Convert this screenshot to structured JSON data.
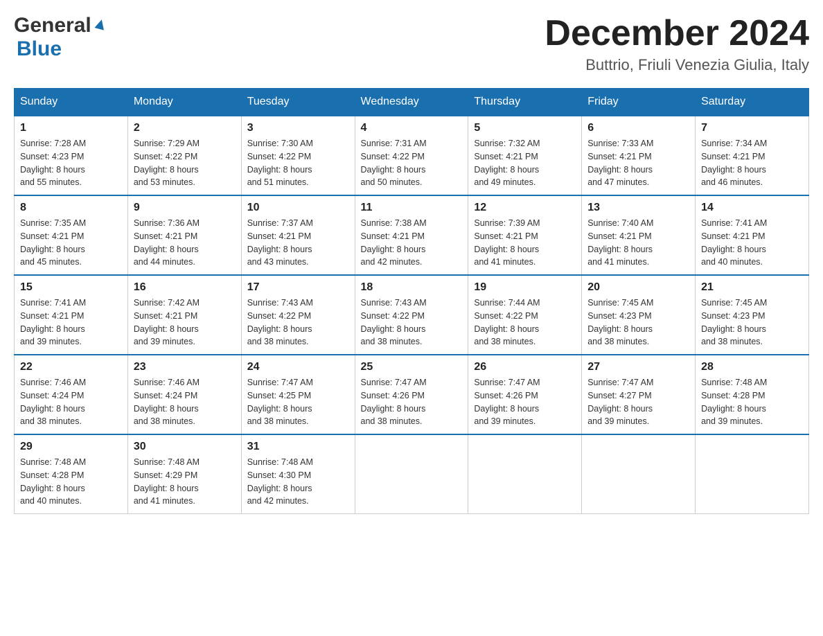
{
  "header": {
    "logo_general": "General",
    "logo_blue": "Blue",
    "month_title": "December 2024",
    "location": "Buttrio, Friuli Venezia Giulia, Italy"
  },
  "days_of_week": [
    "Sunday",
    "Monday",
    "Tuesday",
    "Wednesday",
    "Thursday",
    "Friday",
    "Saturday"
  ],
  "weeks": [
    [
      {
        "day": "1",
        "sunrise": "7:28 AM",
        "sunset": "4:23 PM",
        "daylight": "8 hours and 55 minutes."
      },
      {
        "day": "2",
        "sunrise": "7:29 AM",
        "sunset": "4:22 PM",
        "daylight": "8 hours and 53 minutes."
      },
      {
        "day": "3",
        "sunrise": "7:30 AM",
        "sunset": "4:22 PM",
        "daylight": "8 hours and 51 minutes."
      },
      {
        "day": "4",
        "sunrise": "7:31 AM",
        "sunset": "4:22 PM",
        "daylight": "8 hours and 50 minutes."
      },
      {
        "day": "5",
        "sunrise": "7:32 AM",
        "sunset": "4:21 PM",
        "daylight": "8 hours and 49 minutes."
      },
      {
        "day": "6",
        "sunrise": "7:33 AM",
        "sunset": "4:21 PM",
        "daylight": "8 hours and 47 minutes."
      },
      {
        "day": "7",
        "sunrise": "7:34 AM",
        "sunset": "4:21 PM",
        "daylight": "8 hours and 46 minutes."
      }
    ],
    [
      {
        "day": "8",
        "sunrise": "7:35 AM",
        "sunset": "4:21 PM",
        "daylight": "8 hours and 45 minutes."
      },
      {
        "day": "9",
        "sunrise": "7:36 AM",
        "sunset": "4:21 PM",
        "daylight": "8 hours and 44 minutes."
      },
      {
        "day": "10",
        "sunrise": "7:37 AM",
        "sunset": "4:21 PM",
        "daylight": "8 hours and 43 minutes."
      },
      {
        "day": "11",
        "sunrise": "7:38 AM",
        "sunset": "4:21 PM",
        "daylight": "8 hours and 42 minutes."
      },
      {
        "day": "12",
        "sunrise": "7:39 AM",
        "sunset": "4:21 PM",
        "daylight": "8 hours and 41 minutes."
      },
      {
        "day": "13",
        "sunrise": "7:40 AM",
        "sunset": "4:21 PM",
        "daylight": "8 hours and 41 minutes."
      },
      {
        "day": "14",
        "sunrise": "7:41 AM",
        "sunset": "4:21 PM",
        "daylight": "8 hours and 40 minutes."
      }
    ],
    [
      {
        "day": "15",
        "sunrise": "7:41 AM",
        "sunset": "4:21 PM",
        "daylight": "8 hours and 39 minutes."
      },
      {
        "day": "16",
        "sunrise": "7:42 AM",
        "sunset": "4:21 PM",
        "daylight": "8 hours and 39 minutes."
      },
      {
        "day": "17",
        "sunrise": "7:43 AM",
        "sunset": "4:22 PM",
        "daylight": "8 hours and 38 minutes."
      },
      {
        "day": "18",
        "sunrise": "7:43 AM",
        "sunset": "4:22 PM",
        "daylight": "8 hours and 38 minutes."
      },
      {
        "day": "19",
        "sunrise": "7:44 AM",
        "sunset": "4:22 PM",
        "daylight": "8 hours and 38 minutes."
      },
      {
        "day": "20",
        "sunrise": "7:45 AM",
        "sunset": "4:23 PM",
        "daylight": "8 hours and 38 minutes."
      },
      {
        "day": "21",
        "sunrise": "7:45 AM",
        "sunset": "4:23 PM",
        "daylight": "8 hours and 38 minutes."
      }
    ],
    [
      {
        "day": "22",
        "sunrise": "7:46 AM",
        "sunset": "4:24 PM",
        "daylight": "8 hours and 38 minutes."
      },
      {
        "day": "23",
        "sunrise": "7:46 AM",
        "sunset": "4:24 PM",
        "daylight": "8 hours and 38 minutes."
      },
      {
        "day": "24",
        "sunrise": "7:47 AM",
        "sunset": "4:25 PM",
        "daylight": "8 hours and 38 minutes."
      },
      {
        "day": "25",
        "sunrise": "7:47 AM",
        "sunset": "4:26 PM",
        "daylight": "8 hours and 38 minutes."
      },
      {
        "day": "26",
        "sunrise": "7:47 AM",
        "sunset": "4:26 PM",
        "daylight": "8 hours and 39 minutes."
      },
      {
        "day": "27",
        "sunrise": "7:47 AM",
        "sunset": "4:27 PM",
        "daylight": "8 hours and 39 minutes."
      },
      {
        "day": "28",
        "sunrise": "7:48 AM",
        "sunset": "4:28 PM",
        "daylight": "8 hours and 39 minutes."
      }
    ],
    [
      {
        "day": "29",
        "sunrise": "7:48 AM",
        "sunset": "4:28 PM",
        "daylight": "8 hours and 40 minutes."
      },
      {
        "day": "30",
        "sunrise": "7:48 AM",
        "sunset": "4:29 PM",
        "daylight": "8 hours and 41 minutes."
      },
      {
        "day": "31",
        "sunrise": "7:48 AM",
        "sunset": "4:30 PM",
        "daylight": "8 hours and 42 minutes."
      },
      null,
      null,
      null,
      null
    ]
  ],
  "labels": {
    "sunrise": "Sunrise:",
    "sunset": "Sunset:",
    "daylight": "Daylight:"
  }
}
